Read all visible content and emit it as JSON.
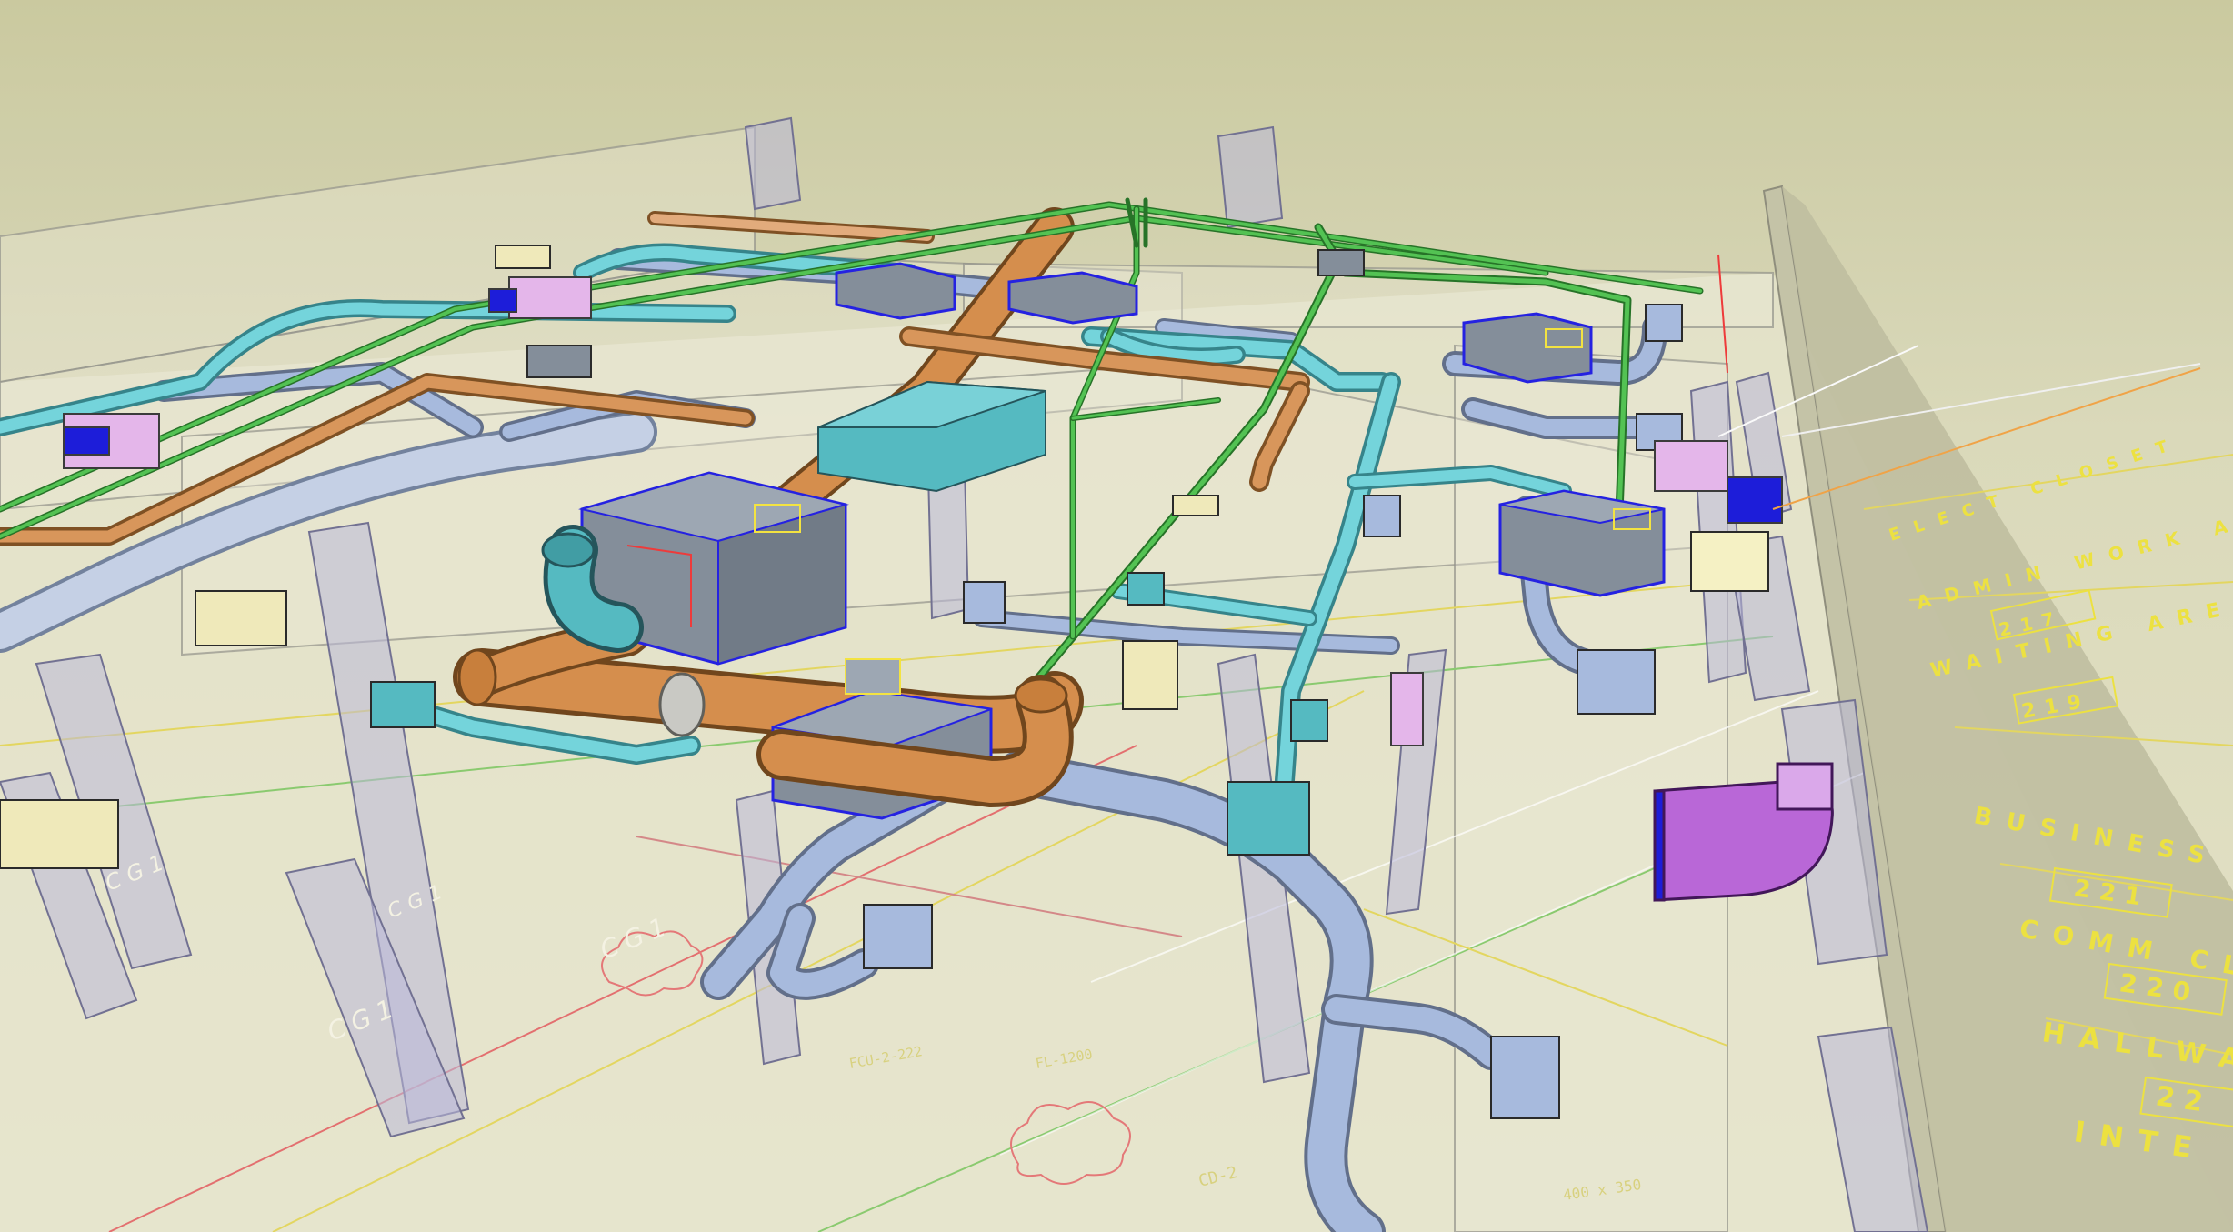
{
  "colors": {
    "background_top": "#c9c89e",
    "background_bottom": "#e2e0c2",
    "supply_duct": "#9fb5d8",
    "return_duct": "#5ec8cf",
    "exhaust_duct": "#d28a46",
    "piping": "#3aa83a",
    "equipment": "#7f8a96",
    "annotation": "#ece03a"
  },
  "room_labels": [
    {
      "name": "ELECT CLOSET",
      "number": ""
    },
    {
      "name": "ADMIN WORK AREA",
      "number": "217"
    },
    {
      "name": "WAITING AREA",
      "number": "219"
    },
    {
      "name": "BUSINESS MACHINE",
      "number": "221"
    },
    {
      "name": "COMM CLOSET",
      "number": "220"
    },
    {
      "name": "HALLWA",
      "number": "22"
    },
    {
      "name": "INTE",
      "number": ""
    }
  ],
  "column_tags": [
    "CG1",
    "CG1",
    "CG1",
    "CG1"
  ],
  "drawing_notes": [
    "CD-2",
    "400 x 350",
    "FCU-2-222",
    "FL-1200"
  ]
}
